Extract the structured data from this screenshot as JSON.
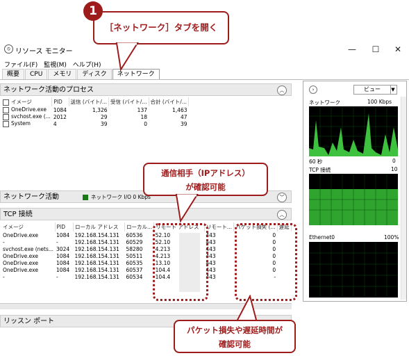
{
  "window": {
    "title": "リソース モニター"
  },
  "menu": [
    "ファイル(F)",
    "監視(M)",
    "ヘルプ(H)"
  ],
  "tabs": [
    "概要",
    "CPU",
    "メモリ",
    "ディスク",
    "ネットワーク"
  ],
  "active_tab": "ネットワーク",
  "callout1": {
    "number": "1",
    "text": "［ネットワーク］タブを開く"
  },
  "callout2": {
    "line1": "通信相手（IPアドレス）",
    "line2": "が確認可能"
  },
  "callout3": {
    "line1": "パケット損失や遅延時間が",
    "line2": "確認可能"
  },
  "process_panel": {
    "title": "ネットワーク活動のプロセス",
    "columns": [
      "イメージ",
      "PID",
      "送信 (バイト/...",
      "受信 (バイト/...",
      "合計 (バイト/..."
    ],
    "rows": [
      [
        "OneDrive.exe",
        "1084",
        "1,326",
        "137",
        "1,463"
      ],
      [
        "svchost.exe (...",
        "2012",
        "29",
        "18",
        "47"
      ],
      [
        "System",
        "4",
        "39",
        "0",
        "39"
      ]
    ]
  },
  "activity_panel": {
    "title": "ネットワーク活動",
    "status": "ネットワーク I/O 0 Kbps"
  },
  "tcp_panel": {
    "title": "TCP 接続",
    "columns": [
      "イメージ",
      "PID",
      "ローカル アドレス",
      "ローカル...",
      "リモート アドレス",
      "リモート...",
      "パケット損失 (...",
      "遅延"
    ],
    "rows": [
      [
        "OneDrive.exe",
        "1084",
        "192.168.154.131",
        "60536",
        "52.10",
        "443",
        "0"
      ],
      [
        "-",
        "-",
        "192.168.154.131",
        "60529",
        "52.10",
        "443",
        "0"
      ],
      [
        "svchost.exe (nets...",
        "3024",
        "192.168.154.131",
        "58280",
        "4.213",
        "443",
        "0"
      ],
      [
        "OneDrive.exe",
        "1084",
        "192.168.154.131",
        "50511",
        "4.213",
        "443",
        "0"
      ],
      [
        "OneDrive.exe",
        "1084",
        "192.168.154.131",
        "60535",
        "13.10",
        "443",
        "0"
      ],
      [
        "OneDrive.exe",
        "1084",
        "192.168.154.131",
        "60537",
        "104.4",
        "443",
        "0"
      ],
      [
        "-",
        "-",
        "192.168.154.131",
        "60534",
        "104.4",
        "443",
        "-"
      ]
    ]
  },
  "listen_panel": {
    "title": "リッスン ポート"
  },
  "right": {
    "view_label": "ビュー",
    "graphs": [
      {
        "name": "ネットワーク",
        "max": "100 Kbps",
        "footer_left": "60 秒",
        "footer_right": "0"
      },
      {
        "name": "TCP 接続",
        "max": "10",
        "footer_left": "",
        "footer_right": ""
      },
      {
        "name": "Ethernet0",
        "max": "100%",
        "footer_left": "",
        "footer_right": ""
      }
    ]
  }
}
